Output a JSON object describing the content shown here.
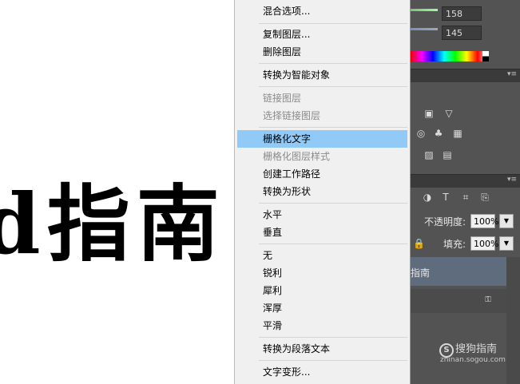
{
  "canvas": {
    "text": "d指南"
  },
  "panel": {
    "color_values": [
      "158",
      "145"
    ],
    "opacity_label": "不透明度:",
    "opacity_value": "100%",
    "fill_label": "填充:",
    "fill_value": "100%",
    "layer_name": "指南",
    "lock_icon": "lock-icon",
    "collapse_glyph": "▾≡"
  },
  "menu": {
    "items": [
      {
        "label": "混合选项...",
        "disabled": false
      },
      {
        "label": "复制图层...",
        "disabled": false
      },
      {
        "label": "删除图层",
        "disabled": false
      },
      {
        "label": "转换为智能对象",
        "disabled": false
      },
      {
        "label": "链接图层",
        "disabled": true
      },
      {
        "label": "选择链接图层",
        "disabled": true
      },
      {
        "label": "栅格化文字",
        "disabled": false,
        "highlighted": true
      },
      {
        "label": "栅格化图层样式",
        "disabled": true
      },
      {
        "label": "创建工作路径",
        "disabled": false
      },
      {
        "label": "转换为形状",
        "disabled": false
      },
      {
        "label": "水平",
        "disabled": false
      },
      {
        "label": "垂直",
        "disabled": false
      },
      {
        "label": "无",
        "disabled": false
      },
      {
        "label": "锐利",
        "disabled": false
      },
      {
        "label": "犀利",
        "disabled": false
      },
      {
        "label": "浑厚",
        "disabled": false
      },
      {
        "label": "平滑",
        "disabled": false
      },
      {
        "label": "转换为段落文本",
        "disabled": false
      },
      {
        "label": "文字变形...",
        "disabled": false
      }
    ]
  },
  "watermark": {
    "brand": "搜狗指南",
    "url": "zhinan.sogou.com",
    "icon_glyph": "S"
  },
  "colors": {
    "highlight": "#91c9f7",
    "panel_bg": "#535353",
    "menu_bg": "#f0f0f0"
  }
}
